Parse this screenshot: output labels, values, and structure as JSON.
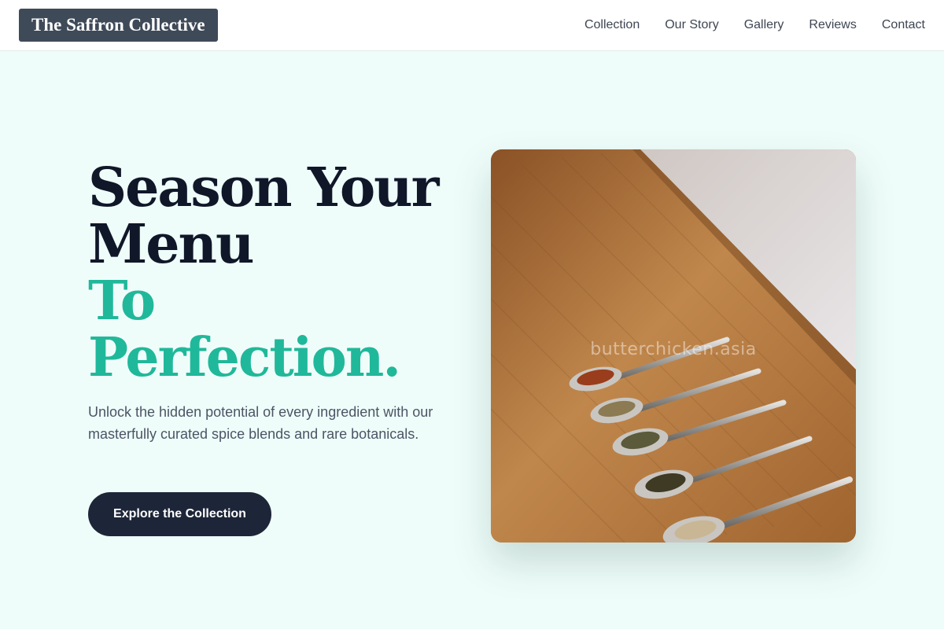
{
  "header": {
    "logo_text": "The Saffron Collective",
    "nav": [
      "Collection",
      "Our Story",
      "Gallery",
      "Reviews",
      "Contact"
    ]
  },
  "hero": {
    "title_line1": "Season Your",
    "title_line2": "Menu",
    "title_line3": "To",
    "title_line4": "Perfection.",
    "subtitle": "Unlock the hidden potential of every ingredient with our masterfully curated spice blends and rare botanicals.",
    "cta_label": "Explore the Collection",
    "image_watermark": "butterchicken.asia"
  },
  "colors": {
    "page_background": "#effdfa",
    "accent_teal": "#20b89a",
    "heading_dark": "#0f1729",
    "button_dark": "#1d2638",
    "logo_background": "#3f4a59"
  }
}
